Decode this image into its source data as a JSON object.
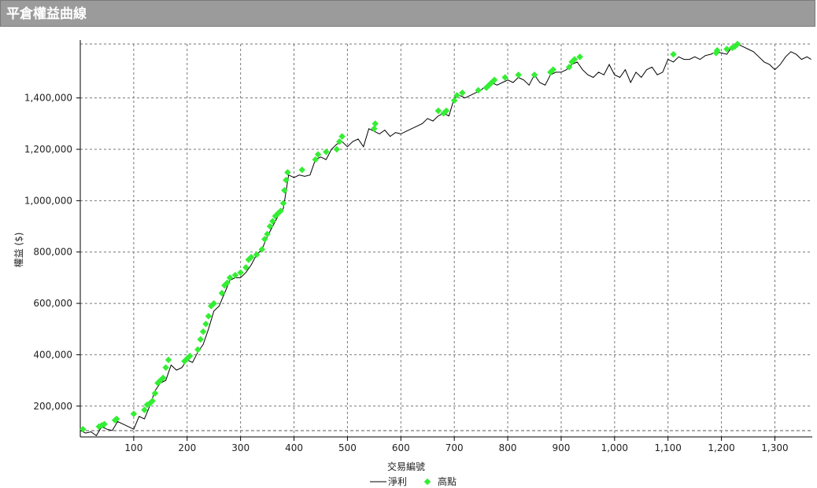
{
  "panel": {
    "title": "平倉權益曲線"
  },
  "chart_data": {
    "type": "line",
    "title": "",
    "xlabel": "交易編號",
    "ylabel": "權益 ($)",
    "xlim": [
      0,
      1370
    ],
    "ylim": [
      80000,
      1610000
    ],
    "xticks": [
      100,
      200,
      300,
      400,
      500,
      600,
      700,
      800,
      900,
      1000,
      1100,
      1200,
      1300
    ],
    "xtick_labels": [
      "100",
      "200",
      "300",
      "400",
      "500",
      "600",
      "700",
      "800",
      "900",
      "1,000",
      "1,100",
      "1,200",
      "1,300"
    ],
    "yticks": [
      200000,
      400000,
      600000,
      800000,
      1000000,
      1200000,
      1400000
    ],
    "ytick_labels": [
      "200,000",
      "400,000",
      "600,000",
      "800,000",
      "1,000,000",
      "1,200,000",
      "1,400,000"
    ],
    "grid": true,
    "legend_position": "bottom-center",
    "series": [
      {
        "name": "淨利",
        "kind": "line",
        "color": "#000000",
        "x": [
          0,
          10,
          20,
          30,
          40,
          50,
          60,
          70,
          80,
          90,
          100,
          110,
          120,
          130,
          140,
          150,
          160,
          170,
          180,
          190,
          200,
          210,
          220,
          230,
          240,
          250,
          260,
          270,
          280,
          290,
          300,
          310,
          320,
          330,
          340,
          350,
          360,
          370,
          380,
          390,
          400,
          410,
          420,
          430,
          440,
          450,
          460,
          470,
          480,
          490,
          500,
          510,
          520,
          530,
          540,
          550,
          560,
          570,
          580,
          590,
          600,
          610,
          620,
          630,
          640,
          650,
          660,
          670,
          680,
          690,
          700,
          710,
          720,
          730,
          740,
          750,
          760,
          770,
          780,
          790,
          800,
          810,
          820,
          830,
          840,
          850,
          860,
          870,
          880,
          890,
          900,
          910,
          920,
          930,
          940,
          950,
          960,
          970,
          980,
          990,
          1000,
          1010,
          1020,
          1030,
          1040,
          1050,
          1060,
          1070,
          1080,
          1090,
          1100,
          1110,
          1120,
          1130,
          1140,
          1150,
          1160,
          1170,
          1180,
          1190,
          1200,
          1210,
          1220,
          1230,
          1240,
          1250,
          1260,
          1270,
          1280,
          1290,
          1300,
          1310,
          1320,
          1330,
          1340,
          1350,
          1360,
          1368
        ],
        "y": [
          105000,
          95000,
          100000,
          85000,
          120000,
          110000,
          105000,
          140000,
          130000,
          120000,
          110000,
          160000,
          150000,
          200000,
          260000,
          290000,
          300000,
          360000,
          340000,
          350000,
          380000,
          370000,
          410000,
          440000,
          500000,
          570000,
          590000,
          640000,
          690000,
          700000,
          700000,
          720000,
          750000,
          790000,
          810000,
          860000,
          900000,
          940000,
          970000,
          1100000,
          1090000,
          1100000,
          1095000,
          1100000,
          1160000,
          1170000,
          1160000,
          1200000,
          1220000,
          1230000,
          1210000,
          1230000,
          1240000,
          1210000,
          1280000,
          1270000,
          1260000,
          1275000,
          1250000,
          1265000,
          1260000,
          1270000,
          1280000,
          1290000,
          1300000,
          1320000,
          1310000,
          1330000,
          1340000,
          1330000,
          1400000,
          1410000,
          1400000,
          1410000,
          1420000,
          1430000,
          1450000,
          1460000,
          1450000,
          1460000,
          1470000,
          1460000,
          1480000,
          1470000,
          1450000,
          1490000,
          1460000,
          1450000,
          1490000,
          1500000,
          1500000,
          1510000,
          1530000,
          1540000,
          1510000,
          1490000,
          1480000,
          1500000,
          1490000,
          1530000,
          1490000,
          1480000,
          1510000,
          1460000,
          1500000,
          1480000,
          1510000,
          1520000,
          1490000,
          1500000,
          1550000,
          1540000,
          1560000,
          1550000,
          1550000,
          1560000,
          1550000,
          1565000,
          1570000,
          1580000,
          1575000,
          1570000,
          1600000,
          1610000,
          1600000,
          1590000,
          1580000,
          1560000,
          1540000,
          1530000,
          1510000,
          1530000,
          1560000,
          1580000,
          1570000,
          1550000,
          1560000,
          1550000
        ]
      },
      {
        "name": "高點",
        "kind": "scatter",
        "color": "#33ee33",
        "x": [
          5,
          35,
          40,
          45,
          65,
          68,
          100,
          120,
          125,
          130,
          135,
          140,
          145,
          150,
          155,
          160,
          165,
          195,
          200,
          205,
          220,
          225,
          230,
          235,
          240,
          245,
          250,
          265,
          270,
          275,
          280,
          290,
          300,
          310,
          315,
          320,
          330,
          340,
          345,
          350,
          355,
          360,
          365,
          370,
          375,
          380,
          382,
          385,
          388,
          415,
          440,
          445,
          460,
          480,
          485,
          490,
          550,
          552,
          670,
          680,
          685,
          700,
          705,
          715,
          745,
          760,
          765,
          770,
          775,
          795,
          820,
          850,
          880,
          885,
          915,
          920,
          925,
          935,
          1110,
          1190,
          1192,
          1210,
          1220,
          1225,
          1230
        ],
        "y": [
          110000,
          120000,
          125000,
          130000,
          145000,
          150000,
          170000,
          185000,
          205000,
          210000,
          220000,
          250000,
          290000,
          300000,
          310000,
          350000,
          380000,
          375000,
          385000,
          395000,
          420000,
          460000,
          490000,
          520000,
          550000,
          590000,
          600000,
          640000,
          670000,
          680000,
          700000,
          710000,
          720000,
          740000,
          770000,
          780000,
          790000,
          810000,
          850000,
          870000,
          900000,
          920000,
          940000,
          950000,
          960000,
          990000,
          1040000,
          1080000,
          1110000,
          1120000,
          1160000,
          1180000,
          1190000,
          1200000,
          1230000,
          1250000,
          1280000,
          1300000,
          1350000,
          1340000,
          1350000,
          1390000,
          1410000,
          1420000,
          1430000,
          1440000,
          1450000,
          1460000,
          1470000,
          1480000,
          1490000,
          1490000,
          1500000,
          1510000,
          1520000,
          1540000,
          1550000,
          1560000,
          1570000,
          1575000,
          1585000,
          1590000,
          1595000,
          1600000,
          1610000
        ]
      }
    ]
  }
}
